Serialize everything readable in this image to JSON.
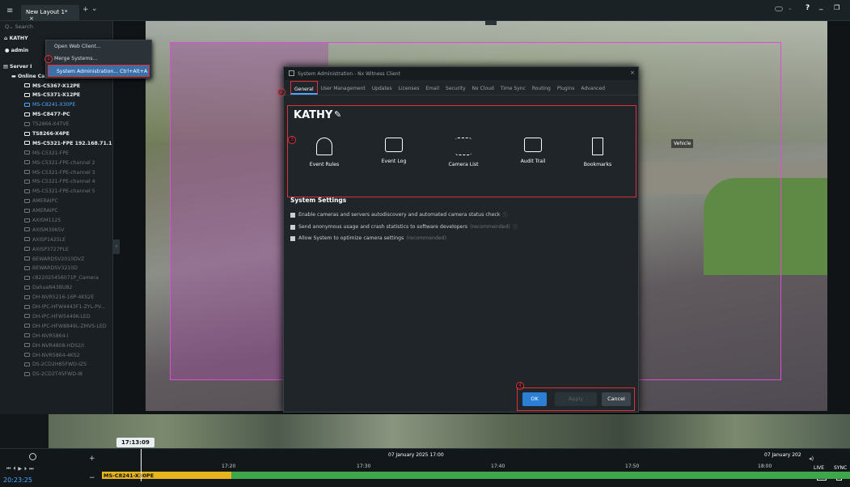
{
  "topbar": {
    "tab_label": "New Layout 1*",
    "close": "×",
    "add": "+",
    "menu": "⌄",
    "help": "?",
    "minimize": "_",
    "restore": "❐"
  },
  "sidebar": {
    "search_placeholder": "Search",
    "user_top": "KATHY",
    "user_admin": "admin",
    "server_label": "Server I",
    "online_cameras": "Online Camera",
    "items": [
      {
        "label": "MS-C5367-X12PE",
        "style": "bright"
      },
      {
        "label": "MS-C5371-X12PE",
        "style": "bright"
      },
      {
        "label": "MS-C8241-X30PE",
        "style": "sel"
      },
      {
        "label": "MS-C8477-PC",
        "style": "bright"
      },
      {
        "label": "TS2866-X4TVE",
        "style": "dim"
      },
      {
        "label": "TS8266-X4PE",
        "style": "bright"
      },
      {
        "label": "MS-C5321-FPE 192.168.71.1...",
        "style": "bright"
      },
      {
        "label": "MS-C5321-FPE",
        "style": "dim"
      },
      {
        "label": "MS-C5321-FPE-channel 2",
        "style": "dim"
      },
      {
        "label": "MS-C5321-FPE-channel 3",
        "style": "dim"
      },
      {
        "label": "MS-C5321-FPE-channel 4",
        "style": "dim"
      },
      {
        "label": "MS-C5321-FPE-channel 5",
        "style": "dim"
      },
      {
        "label": "AMERAIPC",
        "style": "dim"
      },
      {
        "label": "AMERAIPC",
        "style": "dim"
      },
      {
        "label": "AXISM1125",
        "style": "dim"
      },
      {
        "label": "AXISM3065V",
        "style": "dim"
      },
      {
        "label": "AXISP1425LE",
        "style": "dim"
      },
      {
        "label": "AXISP3727PLE",
        "style": "dim"
      },
      {
        "label": "BEWARDSV2010DVZ",
        "style": "dim"
      },
      {
        "label": "BEWARDSV3210D",
        "style": "dim"
      },
      {
        "label": "c822025456071P_Camera",
        "style": "dim"
      },
      {
        "label": "DahuaN43BU82",
        "style": "dim"
      },
      {
        "label": "DH-NVR5216-16P-4KS2E",
        "style": "dim"
      },
      {
        "label": "DH-IPC-HFW4443F1-ZYL-PV...",
        "style": "dim"
      },
      {
        "label": "DH-IPC-HFW5449K-LED",
        "style": "dim"
      },
      {
        "label": "DH-IPC-HFW8849L-ZMVS-LED",
        "style": "dim"
      },
      {
        "label": "DH-NVR5864-I",
        "style": "dim"
      },
      {
        "label": "DH-NVR4808-HDS2/I",
        "style": "dim"
      },
      {
        "label": "DH-NVR5864-4KS2",
        "style": "dim"
      },
      {
        "label": "DS-2CD2H85FWD-IZS",
        "style": "dim"
      },
      {
        "label": "DS-2CD2T45FWD-I8",
        "style": "dim"
      }
    ]
  },
  "context_menu": {
    "items": [
      "Open Web Client...",
      "Merge Systems...",
      "System Administration...  Ctrl+Alt+A"
    ]
  },
  "dialog": {
    "title": "System Administration - Nx Witness Client",
    "tabs": [
      "General",
      "User Management",
      "Updates",
      "Licenses",
      "Email",
      "Security",
      "Nx Cloud",
      "Time Sync",
      "Routing",
      "Plugins",
      "Advanced"
    ],
    "system_name": "KATHY",
    "tiles": [
      "Event Rules",
      "Event Log",
      "Camera List",
      "Audit Trail",
      "Bookmarks"
    ],
    "settings_heading": "System Settings",
    "checks": [
      {
        "text": "Enable cameras and servers autodiscovery and automated camera status check",
        "extra": ""
      },
      {
        "text": "Send anonymous usage and crash statistics to software developers",
        "extra": "(recommended)"
      },
      {
        "text": "Allow System to optimize camera settings",
        "extra": "(recommended)"
      }
    ],
    "ok": "OK",
    "apply": "Apply",
    "cancel": "Cancel"
  },
  "markers": [
    "1",
    "2",
    "3",
    "4"
  ],
  "vehicle_label": "Vehicle",
  "timeline": {
    "cursor_time": "17:13:09",
    "date_label": "07 January 2025 17:00",
    "date_label_right": "07 January 202",
    "ticks": [
      "17:20",
      "17:30",
      "17:40",
      "17:50",
      "18:00"
    ],
    "clock": "20:23:25",
    "camera": "MS-C8241-X30PE",
    "live": "LIVE",
    "sync": "SYNC"
  },
  "colors": {
    "accent": "#4ea5ff",
    "highlight": "#e0313b",
    "roi": "#e04cd8",
    "track_green": "#3da74a",
    "track_yellow": "#e6b51e"
  }
}
